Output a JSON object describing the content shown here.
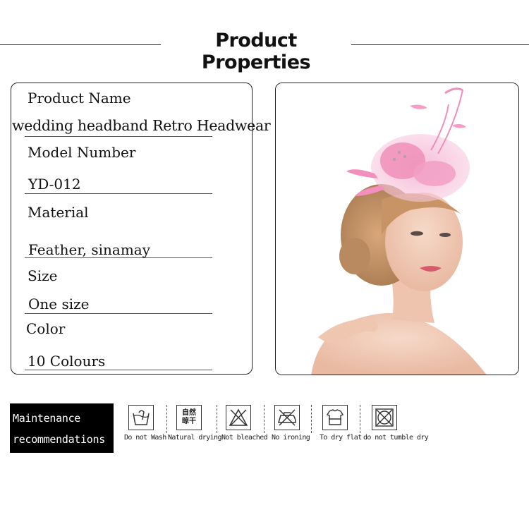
{
  "header": {
    "title": "Product Properties"
  },
  "properties": [
    {
      "label": "Product Name",
      "value": "wedding headband Retro Headwear"
    },
    {
      "label": "Model Number",
      "value": "YD-012"
    },
    {
      "label": "Material",
      "value": "Feather, sinamay"
    },
    {
      "label": "Size",
      "value": "One size"
    },
    {
      "label": "Color",
      "value": "10 Colours"
    }
  ],
  "photo": {
    "subject": "woman-wearing-pink-feather-fascinator"
  },
  "maintenance": {
    "title_line1": "Maintenance",
    "title_line2": "recommendations",
    "items": [
      {
        "icon": "do-not-wash-icon",
        "caption": "Do not Wash"
      },
      {
        "icon": "natural-drying-icon",
        "caption": "Natural drying",
        "icon_text_1": "自然",
        "icon_text_2": "晾干"
      },
      {
        "icon": "not-bleached-icon",
        "caption": "Not bleached"
      },
      {
        "icon": "no-ironing-icon",
        "caption": "No ironing"
      },
      {
        "icon": "dry-flat-icon",
        "caption": "To dry flat"
      },
      {
        "icon": "no-tumble-dry-icon",
        "caption": "do not tumble dry"
      }
    ]
  },
  "colors": {
    "accent_pink": "#f2a6c6",
    "text": "#111111",
    "panel_border": "#222222"
  }
}
